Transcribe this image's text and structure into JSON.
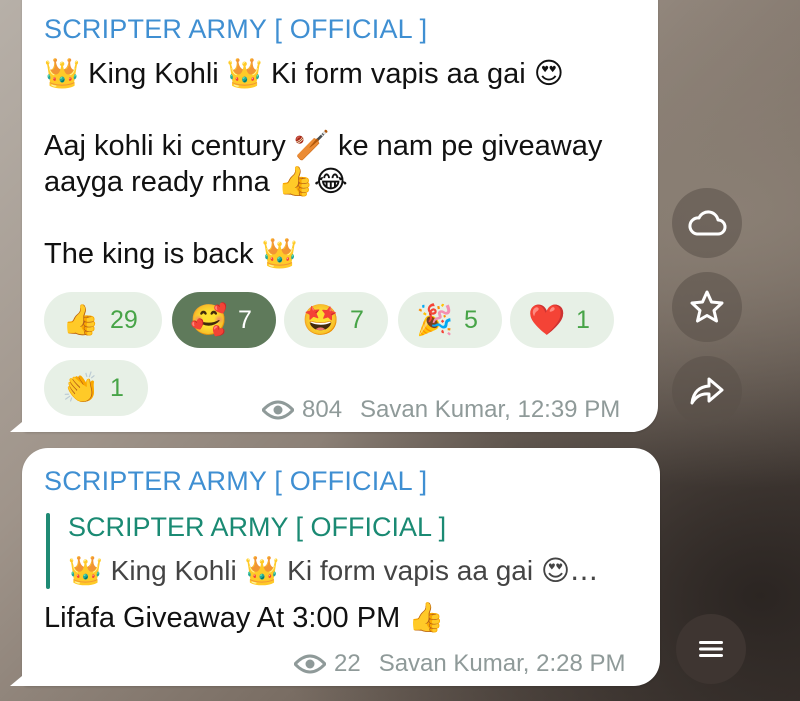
{
  "message1": {
    "sender": "SCRIPTER ARMY [ OFFICIAL ]",
    "line1_a": "👑",
    "line1_b": " King Kohli ",
    "line1_c": "👑",
    "line1_d": " Ki form vapis aa gai ",
    "line1_e": "😍",
    "line2_a": "Aaj kohli ki century ",
    "line2_b": "🏏",
    "line2_c": " ke nam pe giveaway",
    "line3_a": "aayga ready rhna ",
    "line3_b": "👍😂",
    "line4_a": "The king is back ",
    "line4_b": "👑",
    "reactions": [
      {
        "emoji": "👍",
        "count": "29"
      },
      {
        "emoji": "🥰",
        "count": "7"
      },
      {
        "emoji": "🤩",
        "count": "7"
      },
      {
        "emoji": "🎉",
        "count": "5"
      },
      {
        "emoji": "❤️",
        "count": "1"
      },
      {
        "emoji": "👏",
        "count": "1"
      }
    ],
    "views": "804",
    "author_time": "Savan Kumar, 12:39 PM"
  },
  "message2": {
    "sender": "SCRIPTER ARMY [ OFFICIAL ]",
    "quote_sender": "SCRIPTER ARMY [ OFFICIAL ]",
    "quote_a": "👑",
    "quote_b": " King Kohli ",
    "quote_c": "👑",
    "quote_d": " Ki form vapis aa gai ",
    "quote_e": "😍…",
    "text_a": "Lifafa Giveaway At 3:00 PM ",
    "text_b": "👍",
    "views": "22",
    "author_time": "Savan Kumar, 2:28 PM"
  },
  "side_buttons": {
    "cloud": "cloud-icon",
    "star": "star-icon",
    "share": "share-icon",
    "menu": "menu-icon"
  },
  "colors": {
    "sender": "#3f8fd2",
    "quote": "#1a8a73",
    "reaction_count": "#47a447",
    "reaction_active_bg": "#5f7a5b",
    "meta": "#8f9a99"
  }
}
